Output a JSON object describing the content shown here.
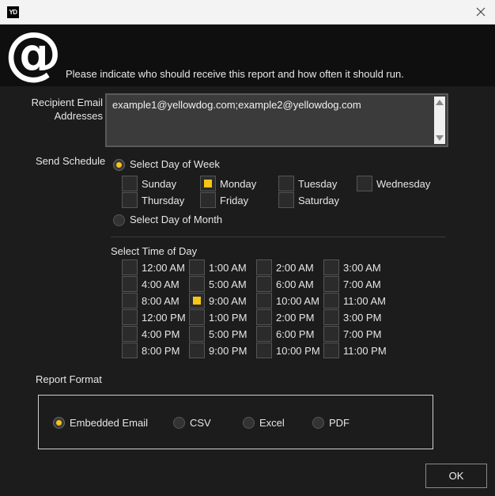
{
  "titlebar": {
    "logo_text": "YD"
  },
  "header": {
    "instruction": "Please indicate who should receive this report and how often it should run."
  },
  "recipients": {
    "label_line1": "Recipient Email",
    "label_line2": "Addresses",
    "value": "example1@yellowdog.com;example2@yellowdog.com"
  },
  "schedule": {
    "label": "Send Schedule",
    "day_of_week_option": "Select Day of Week",
    "day_of_month_option": "Select Day of Month",
    "selected_mode": "day_of_week",
    "days": [
      {
        "label": "Sunday",
        "checked": false
      },
      {
        "label": "Monday",
        "checked": true
      },
      {
        "label": "Tuesday",
        "checked": false
      },
      {
        "label": "Wednesday",
        "checked": false
      },
      {
        "label": "Thursday",
        "checked": false
      },
      {
        "label": "Friday",
        "checked": false
      },
      {
        "label": "Saturday",
        "checked": false
      }
    ]
  },
  "time_of_day": {
    "label": "Select Time of Day",
    "times": [
      {
        "label": "12:00 AM",
        "checked": false
      },
      {
        "label": "1:00 AM",
        "checked": false
      },
      {
        "label": "2:00 AM",
        "checked": false
      },
      {
        "label": "3:00 AM",
        "checked": false
      },
      {
        "label": "4:00 AM",
        "checked": false
      },
      {
        "label": "5:00 AM",
        "checked": false
      },
      {
        "label": "6:00 AM",
        "checked": false
      },
      {
        "label": "7:00 AM",
        "checked": false
      },
      {
        "label": "8:00 AM",
        "checked": false
      },
      {
        "label": "9:00 AM",
        "checked": true
      },
      {
        "label": "10:00 AM",
        "checked": false
      },
      {
        "label": "11:00 AM",
        "checked": false
      },
      {
        "label": "12:00 PM",
        "checked": false
      },
      {
        "label": "1:00 PM",
        "checked": false
      },
      {
        "label": "2:00 PM",
        "checked": false
      },
      {
        "label": "3:00 PM",
        "checked": false
      },
      {
        "label": "4:00 PM",
        "checked": false
      },
      {
        "label": "5:00 PM",
        "checked": false
      },
      {
        "label": "6:00 PM",
        "checked": false
      },
      {
        "label": "7:00 PM",
        "checked": false
      },
      {
        "label": "8:00 PM",
        "checked": false
      },
      {
        "label": "9:00 PM",
        "checked": false
      },
      {
        "label": "10:00 PM",
        "checked": false
      },
      {
        "label": "11:00 PM",
        "checked": false
      }
    ]
  },
  "report_format": {
    "label": "Report Format",
    "options": [
      {
        "label": "Embedded Email",
        "selected": true
      },
      {
        "label": "CSV",
        "selected": false
      },
      {
        "label": "Excel",
        "selected": false
      },
      {
        "label": "PDF",
        "selected": false
      }
    ]
  },
  "ok_label": "OK",
  "colors": {
    "accent": "#f5c518",
    "background": "#1c1c1c",
    "header": "#0f0f0f",
    "field": "#3b3b3b"
  }
}
